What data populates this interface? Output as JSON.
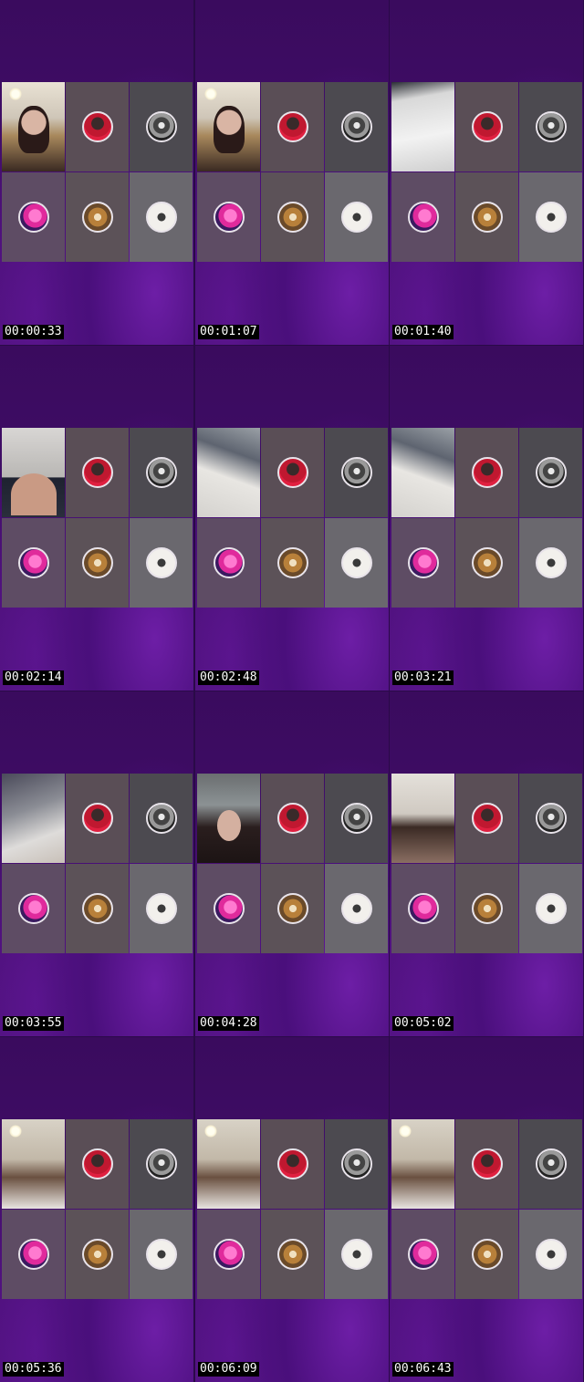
{
  "sheet": {
    "frames": [
      {
        "timestamp": "00:00:33",
        "camera": "v1"
      },
      {
        "timestamp": "00:01:07",
        "camera": "v1"
      },
      {
        "timestamp": "00:01:40",
        "camera": "v2"
      },
      {
        "timestamp": "00:02:14",
        "camera": "v3"
      },
      {
        "timestamp": "00:02:48",
        "camera": "v4"
      },
      {
        "timestamp": "00:03:21",
        "camera": "v4"
      },
      {
        "timestamp": "00:03:55",
        "camera": "v5"
      },
      {
        "timestamp": "00:04:28",
        "camera": "v6"
      },
      {
        "timestamp": "00:05:02",
        "camera": "v7"
      },
      {
        "timestamp": "00:05:36",
        "camera": "v8"
      },
      {
        "timestamp": "00:06:09",
        "camera": "v8"
      },
      {
        "timestamp": "00:06:43",
        "camera": "v8"
      }
    ],
    "participant_avatars": [
      {
        "name": "red-portrait-avatar",
        "style": "av-red"
      },
      {
        "name": "bw-portrait-avatar",
        "style": "av-bw"
      },
      {
        "name": "pink-avatar",
        "style": "av-pink"
      },
      {
        "name": "dog-avatar",
        "style": "av-dog"
      },
      {
        "name": "room-avatar",
        "style": "av-room"
      }
    ],
    "colors": {
      "background": "#3f0d66",
      "accent": "#6d1ea6",
      "timestamp_bg": "#000000",
      "timestamp_text": "#ffffff"
    }
  }
}
